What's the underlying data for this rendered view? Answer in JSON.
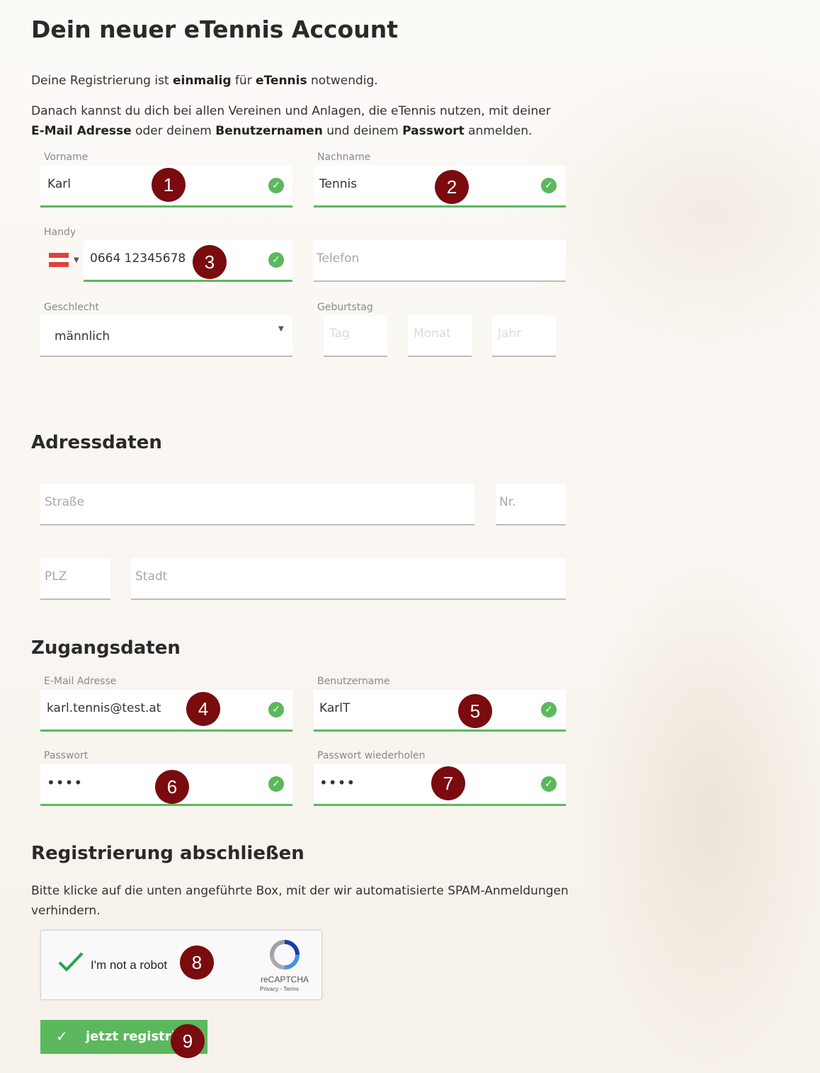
{
  "page": {
    "title": "Dein neuer eTennis Account",
    "intro1": {
      "a": "Deine Registrierung ist ",
      "b": "einmalig",
      "c": " für ",
      "d": "eTennis",
      "e": " notwendig."
    },
    "intro2": {
      "a": "Danach kannst du dich bei allen Vereinen und Anlagen, die eTennis nutzen, mit deiner",
      "b": "E-Mail Adresse",
      "c": " oder deinem ",
      "d": "Benutzernamen",
      "e": " und deinem ",
      "f": "Passwort",
      "g": " anmelden."
    }
  },
  "personal": {
    "firstname": {
      "label": "Vorname",
      "value": "Karl"
    },
    "lastname": {
      "label": "Nachname",
      "value": "Tennis"
    },
    "mobile": {
      "label": "Handy",
      "value": "0664 12345678"
    },
    "phone": {
      "placeholder": "Telefon"
    },
    "gender": {
      "label": "Geschlecht",
      "value": "männlich"
    },
    "birthday": {
      "label": "Geburtstag",
      "day": "Tag",
      "month": "Monat",
      "year": "Jahr"
    }
  },
  "address": {
    "heading": "Adressdaten",
    "street": "Straße",
    "number": "Nr.",
    "zip": "PLZ",
    "city": "Stadt"
  },
  "access": {
    "heading": "Zugangsdaten",
    "email": {
      "label": "E-Mail Adresse",
      "value": "karl.tennis@test.at"
    },
    "username": {
      "label": "Benutzername",
      "value": "KarlT"
    },
    "password": {
      "label": "Passwort",
      "value": "••••"
    },
    "password_repeat": {
      "label": "Passwort wiederholen",
      "value": "••••"
    }
  },
  "finish": {
    "heading": "Registrierung abschließen",
    "text1": "Bitte klicke auf die unten angeführte Box, mit der wir automatisierte SPAM-Anmeldungen",
    "text2": "verhindern.",
    "captcha_label": "I'm not a robot",
    "captcha_brand": "reCAPTCHA",
    "captcha_links": "Privacy - Terms",
    "submit": "jetzt registrie"
  },
  "markers": [
    "1",
    "2",
    "3",
    "4",
    "5",
    "6",
    "7",
    "8",
    "9"
  ],
  "colors": {
    "valid": "#5cb85c",
    "marker": "#7a0b0e",
    "button": "#5cb85c"
  }
}
